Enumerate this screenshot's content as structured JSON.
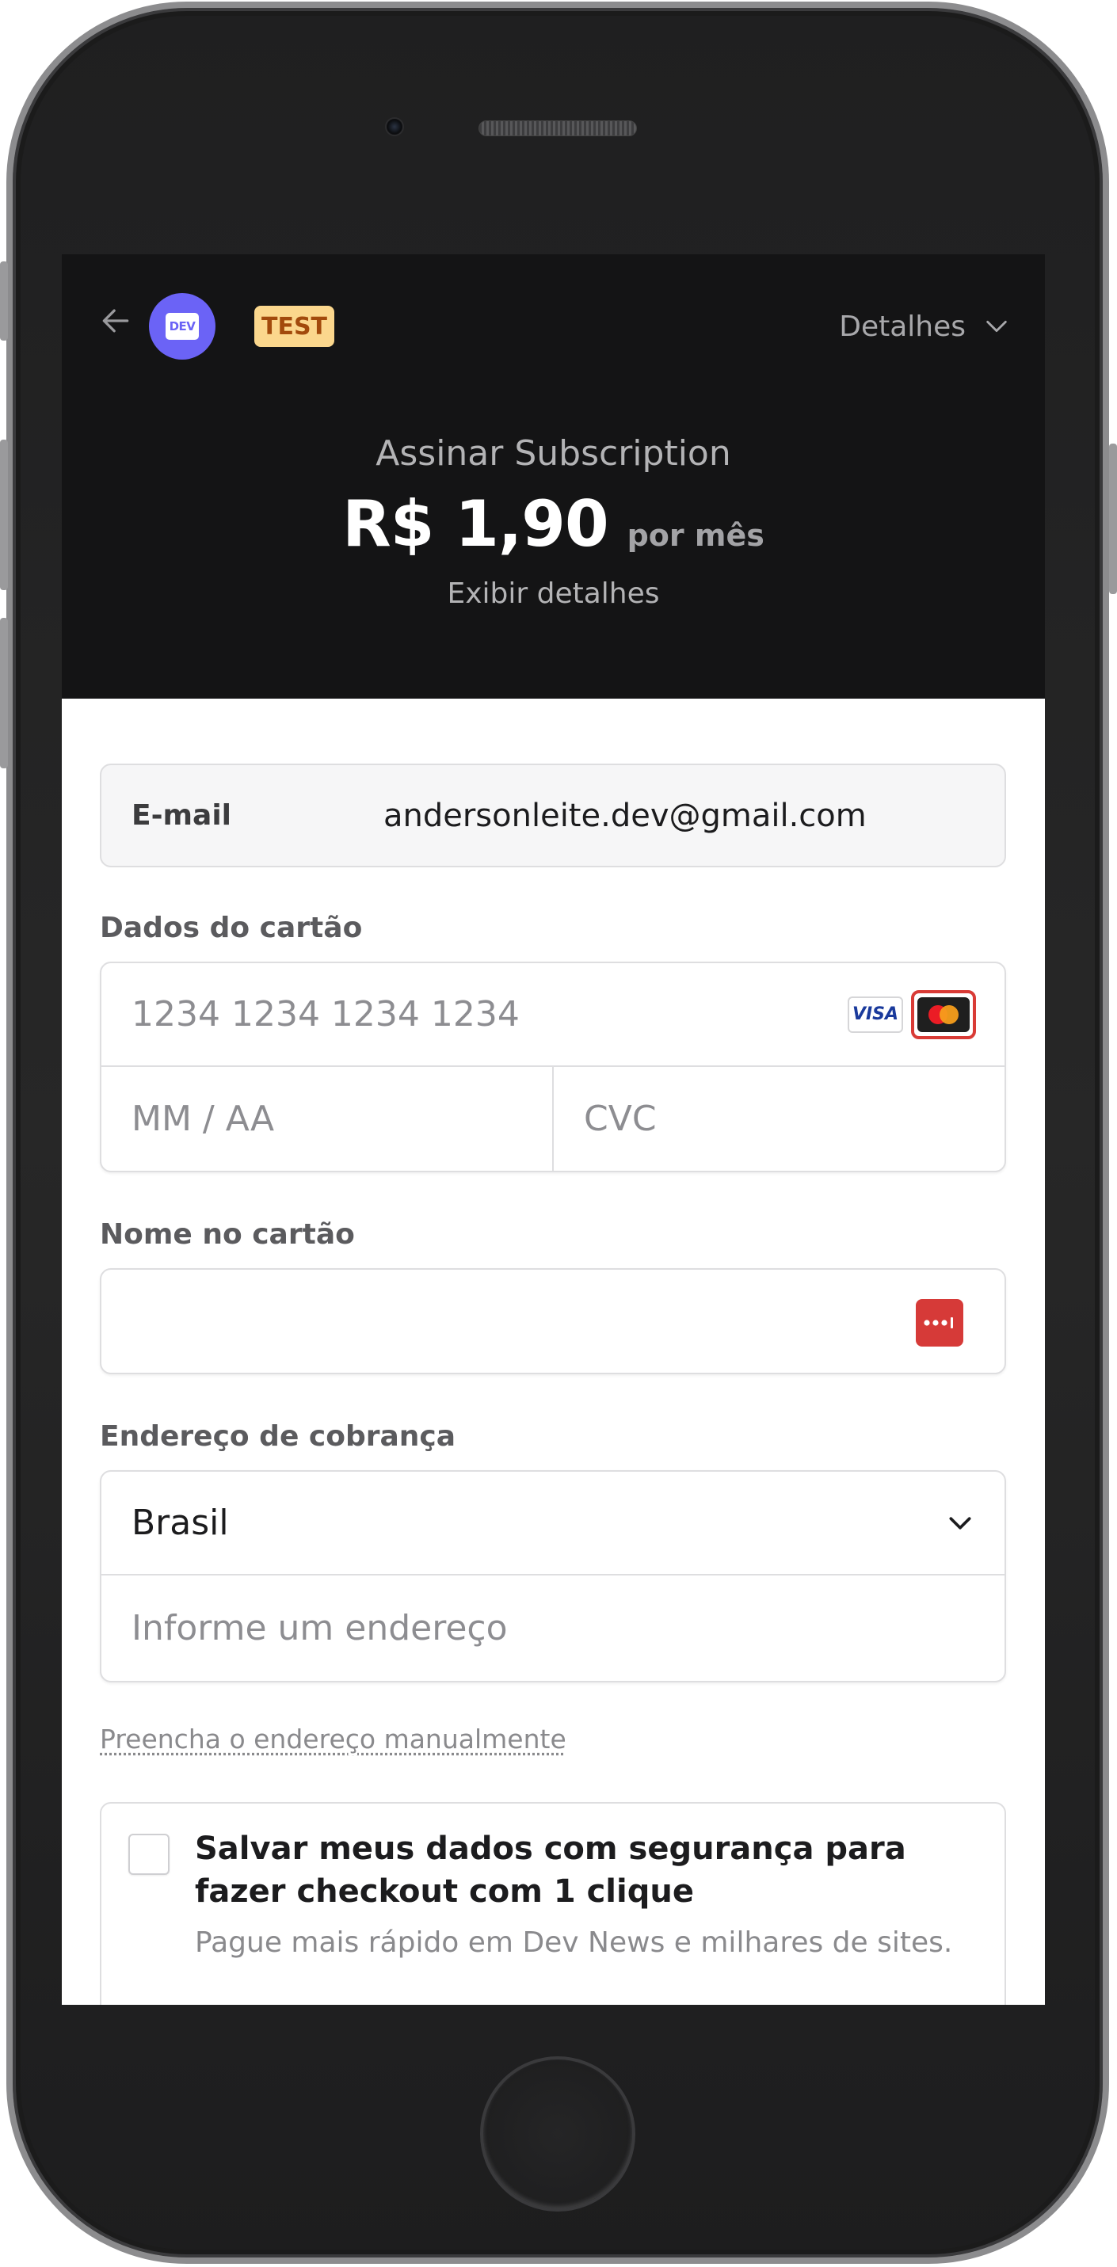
{
  "header": {
    "avatar_text": "DEV",
    "badge": "TEST",
    "details_label": "Detalhes"
  },
  "product": {
    "name": "Assinar Subscription",
    "price": "R$ 1,90",
    "period": "por mês",
    "view_details": "Exibir detalhes"
  },
  "form": {
    "email_label": "E-mail",
    "email_value": "andersonleite.dev@gmail.com",
    "card_label": "Dados do cartão",
    "card_number_placeholder": "1234 1234 1234 1234",
    "card_brands": [
      "VISA",
      "mastercard"
    ],
    "expiry_placeholder": "MM / AA",
    "cvc_placeholder": "CVC",
    "name_label": "Nome no cartão",
    "name_value": "",
    "billing_label": "Endereço de cobrança",
    "country_value": "Brasil",
    "address_placeholder": "Informe um endereço",
    "manual_address_link": "Preencha o endereço manualmente",
    "save_title": "Salvar meus dados com segurança para fazer checkout com 1 clique",
    "save_subtitle": "Pague mais rápido em Dev News e milhares de sites.",
    "save_checked": false
  },
  "colors": {
    "header_bg": "#141415",
    "avatar_bg": "#6b63f6",
    "badge_bg": "#fbd78d",
    "badge_text": "#a24a0c",
    "autofill_icon": "#d63a38"
  }
}
